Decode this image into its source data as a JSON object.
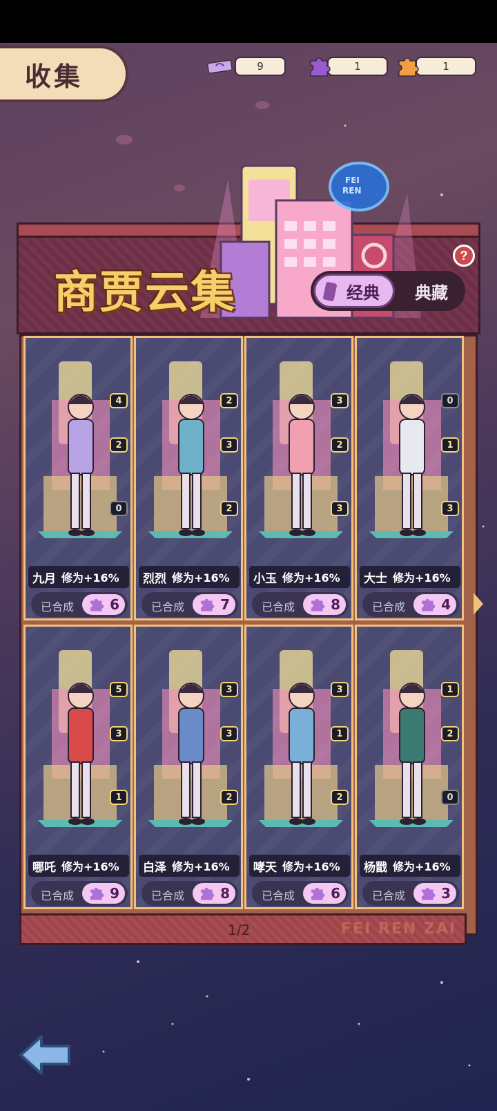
{
  "header": {
    "title": "收集"
  },
  "resources": [
    {
      "icon": "ticket-icon",
      "value": "9"
    },
    {
      "icon": "purple-puzzle-icon",
      "value": "1"
    },
    {
      "icon": "orange-puzzle-icon",
      "value": "1"
    }
  ],
  "banner": {
    "title": "商贾云集",
    "tab_classic": "经典",
    "tab_collection": "典藏",
    "help": "?"
  },
  "cards": [
    {
      "name": "九月",
      "bonus": "修为+16%",
      "badges": [
        "4",
        "2",
        "0"
      ],
      "composed_label": "已合成",
      "count": "6"
    },
    {
      "name": "烈烈",
      "bonus": "修为+16%",
      "badges": [
        "2",
        "3",
        "2"
      ],
      "composed_label": "已合成",
      "count": "7"
    },
    {
      "name": "小玉",
      "bonus": "修为+16%",
      "badges": [
        "3",
        "2",
        "3"
      ],
      "composed_label": "已合成",
      "count": "8"
    },
    {
      "name": "大士",
      "bonus": "修为+16%",
      "badges": [
        "0",
        "1",
        "3"
      ],
      "composed_label": "已合成",
      "count": "4"
    },
    {
      "name": "哪吒",
      "bonus": "修为+16%",
      "badges": [
        "5",
        "3",
        "1"
      ],
      "composed_label": "已合成",
      "count": "9"
    },
    {
      "name": "白泽",
      "bonus": "修为+16%",
      "badges": [
        "3",
        "3",
        "2"
      ],
      "composed_label": "已合成",
      "count": "8"
    },
    {
      "name": "哮天",
      "bonus": "修为+16%",
      "badges": [
        "3",
        "1",
        "2"
      ],
      "composed_label": "已合成",
      "count": "6"
    },
    {
      "name": "杨戬",
      "bonus": "修为+16%",
      "badges": [
        "1",
        "2",
        "0"
      ],
      "composed_label": "已合成",
      "count": "3"
    }
  ],
  "pager": {
    "page": "1/2",
    "brand": "FEI REN ZAI"
  },
  "colors": {
    "accent": "#f5cf6a",
    "card_bg": "#4a4a72",
    "pill": "#f5c8f3",
    "frame": "#a84b52"
  }
}
